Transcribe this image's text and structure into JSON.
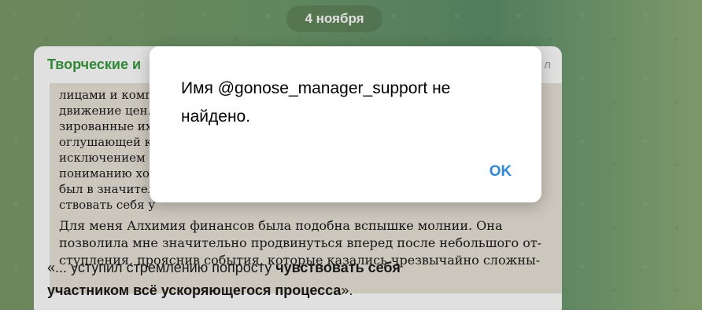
{
  "chat": {
    "date_label": "4 ноября",
    "message": {
      "channel_name": "Творческие и",
      "header_right": "л",
      "photo_lines": [
        "лицами и комп",
        "движение цен.",
        "зированные их",
        "оглушающей к",
        "исключением",
        "пониманию хо",
        "был в значител",
        "ствовать себя у",
        "Для меня Алхимия финансов была подобна вспышке молнии. Она",
        "позволила мне значительно продвинуться вперед после небольшого от-",
        "ступления, прояснив события, которые казались чрезвычайно сложны-"
      ],
      "caption_plain": "«... уступил стремлению попросту ",
      "caption_bold_1": "чувствовать себя",
      "caption_bold_2": "участником всё ускоряющегося процесса",
      "caption_end": "»."
    }
  },
  "dialog": {
    "message": "Имя @gonose_manager_support не найдено.",
    "ok_label": "OK"
  },
  "colors": {
    "accent": "#2f86d3",
    "channel_name": "#3a9a3f"
  }
}
